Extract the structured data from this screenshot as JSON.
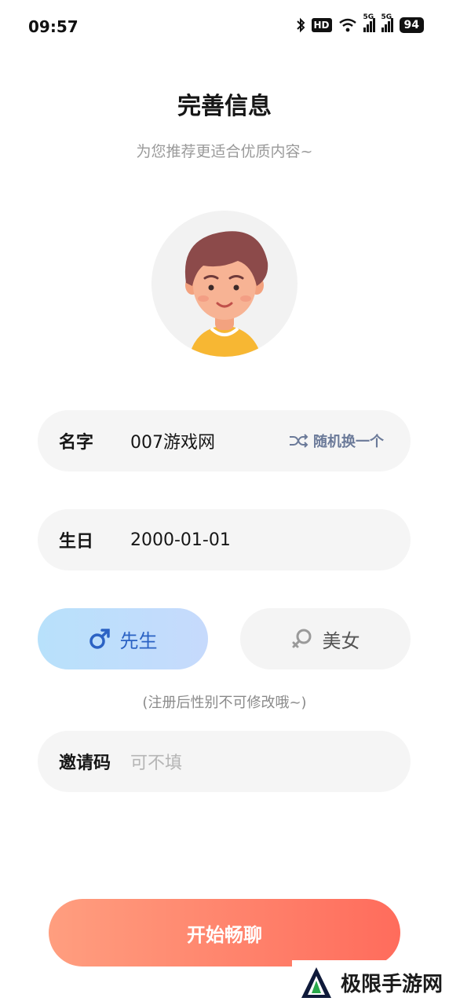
{
  "status_bar": {
    "time": "09:57",
    "hd_label": "HD",
    "signal1_label": "5G",
    "signal2_label": "5G",
    "battery": "94"
  },
  "header": {
    "title": "完善信息",
    "subtitle": "为您推荐更适合优质内容~"
  },
  "form": {
    "name": {
      "label": "名字",
      "value": "007游戏网",
      "random_label": "随机换一个"
    },
    "birthday": {
      "label": "生日",
      "value": "2000-01-01"
    },
    "gender": {
      "male_label": "先生",
      "female_label": "美女",
      "selected": "male",
      "note": "(注册后性别不可修改哦~)"
    },
    "invite": {
      "label": "邀请码",
      "placeholder": "可不填"
    }
  },
  "start_button": {
    "label": "开始畅聊"
  },
  "watermark": {
    "text": "极限手游网"
  },
  "colors": {
    "accent_start": "#ff9e7f",
    "accent_end": "#ff6c5c",
    "male_selected_bg": "#b8e1fb",
    "male_text": "#2b62c4"
  }
}
